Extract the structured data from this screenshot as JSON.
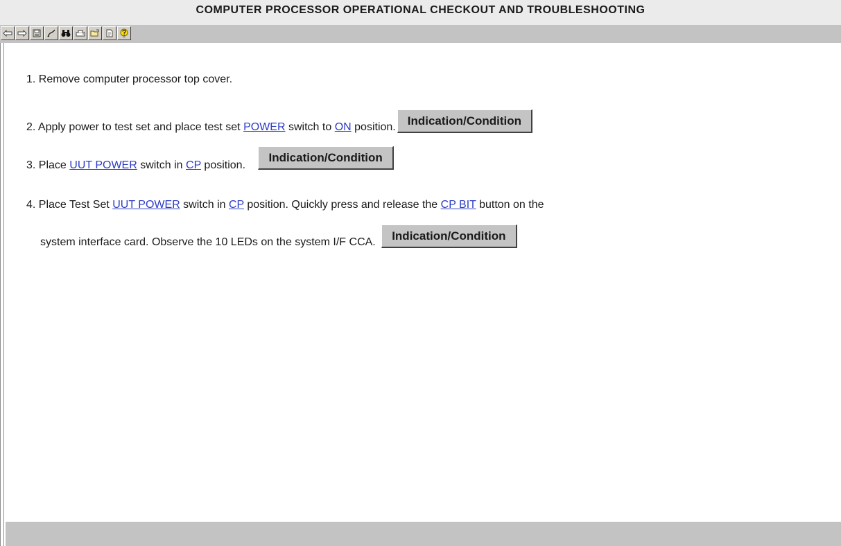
{
  "page": {
    "title": "COMPUTER PROCESSOR OPERATIONAL CHECKOUT AND TROUBLESHOOTING"
  },
  "toolbar": {
    "buttons": [
      {
        "icon": "back-arrow-icon"
      },
      {
        "icon": "forward-arrow-icon"
      },
      {
        "icon": "save-icon"
      },
      {
        "icon": "pen-icon"
      },
      {
        "icon": "binoculars-icon"
      },
      {
        "icon": "print-icon"
      },
      {
        "icon": "open-folder-icon"
      },
      {
        "icon": "document-icon"
      },
      {
        "icon": "help-icon"
      }
    ]
  },
  "colors": {
    "title_bar": "#ebebeb",
    "toolbar_strip": "#c3c3c3",
    "link": "#2b3cc4",
    "button_face": "#c4c4c4"
  },
  "steps": [
    {
      "number": "1.",
      "text": "Remove computer processor top cover."
    },
    {
      "number": "2.",
      "t1": "Apply power to test set and place test set",
      "link1": "POWER",
      "t2": "switch to",
      "link2": "ON",
      "t3": "position.",
      "button": "Indication/Condition"
    },
    {
      "number": "3.",
      "t1": "Place",
      "link1": "UUT POWER",
      "t2": "switch in",
      "link2": "CP",
      "t3": "position.",
      "button": "Indication/Condition"
    },
    {
      "number": "4.",
      "t1": "Place Test Set",
      "link1": "UUT POWER",
      "t2": "switch in",
      "link2": "CP",
      "t3": "position. Quickly press and release the",
      "link3": "CP BIT",
      "t4": "button on the",
      "line2": "system interface card. Observe the 10 LEDs on the system I/F CCA.",
      "button": "Indication/Condition"
    }
  ]
}
